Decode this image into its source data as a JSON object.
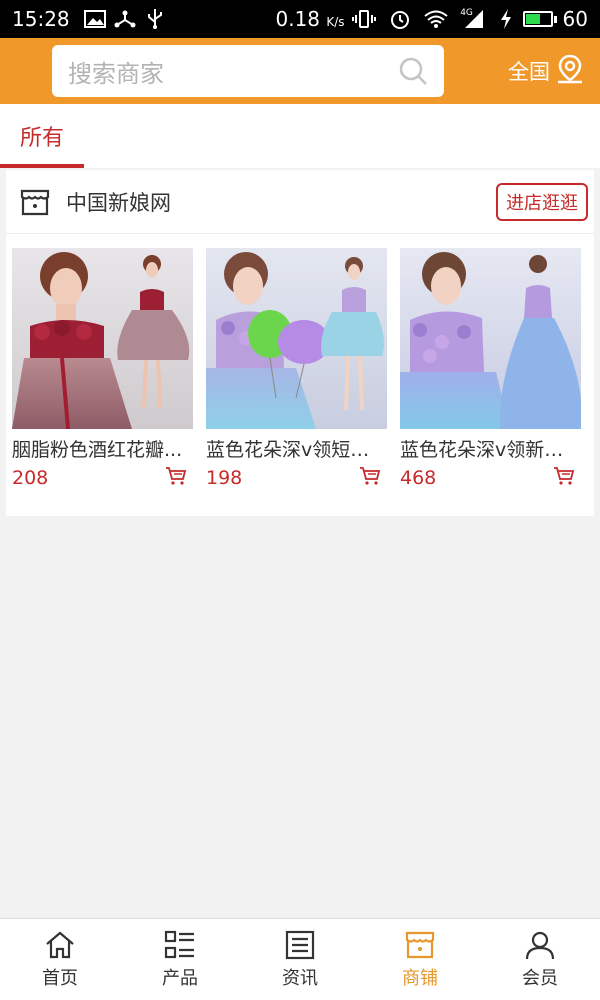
{
  "status_bar": {
    "time": "15:28",
    "speed": "0.18",
    "speed_unit": "K/s",
    "network": "4G",
    "battery": "60"
  },
  "header": {
    "search_placeholder": "搜索商家",
    "region_label": "全国"
  },
  "tabs": [
    {
      "label": "所有",
      "active": true
    }
  ],
  "shop": {
    "name": "中国新娘网",
    "visit_label": "进店逛逛",
    "products": [
      {
        "title": "胭脂粉色酒红花瓣...",
        "price": "208",
        "image": "bride-dress-pink-red"
      },
      {
        "title": "蓝色花朵深v领短款...",
        "price": "198",
        "image": "bride-dress-blue-short"
      },
      {
        "title": "蓝色花朵深v领新娘...",
        "price": "468",
        "image": "bride-dress-blue-long"
      }
    ]
  },
  "bottom_nav": [
    {
      "label": "首页",
      "icon": "home-icon",
      "active": false
    },
    {
      "label": "产品",
      "icon": "list-icon",
      "active": false
    },
    {
      "label": "资讯",
      "icon": "news-icon",
      "active": false
    },
    {
      "label": "商铺",
      "icon": "shop-icon",
      "active": true
    },
    {
      "label": "会员",
      "icon": "user-icon",
      "active": false
    }
  ],
  "colors": {
    "header": "#f0982a",
    "accent_red": "#c72a2a",
    "nav_active": "#e7972c"
  }
}
